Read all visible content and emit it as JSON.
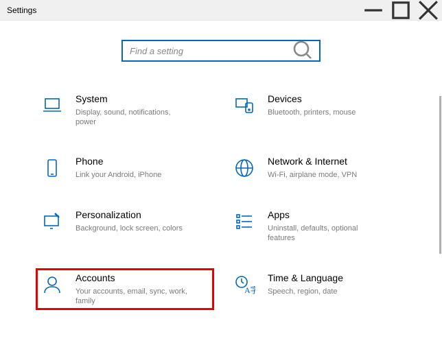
{
  "window": {
    "title": "Settings"
  },
  "search": {
    "placeholder": "Find a setting"
  },
  "categories": [
    {
      "id": "system",
      "title": "System",
      "desc": "Display, sound, notifications, power",
      "icon": "laptop-icon"
    },
    {
      "id": "devices",
      "title": "Devices",
      "desc": "Bluetooth, printers, mouse",
      "icon": "devices-icon"
    },
    {
      "id": "phone",
      "title": "Phone",
      "desc": "Link your Android, iPhone",
      "icon": "phone-icon"
    },
    {
      "id": "network",
      "title": "Network & Internet",
      "desc": "Wi-Fi, airplane mode, VPN",
      "icon": "globe-icon"
    },
    {
      "id": "personalization",
      "title": "Personalization",
      "desc": "Background, lock screen, colors",
      "icon": "personalization-icon"
    },
    {
      "id": "apps",
      "title": "Apps",
      "desc": "Uninstall, defaults, optional features",
      "icon": "apps-icon"
    },
    {
      "id": "accounts",
      "title": "Accounts",
      "desc": "Your accounts, email, sync, work, family",
      "icon": "person-icon",
      "highlighted": true
    },
    {
      "id": "time",
      "title": "Time & Language",
      "desc": "Speech, region, date",
      "icon": "time-language-icon"
    }
  ]
}
